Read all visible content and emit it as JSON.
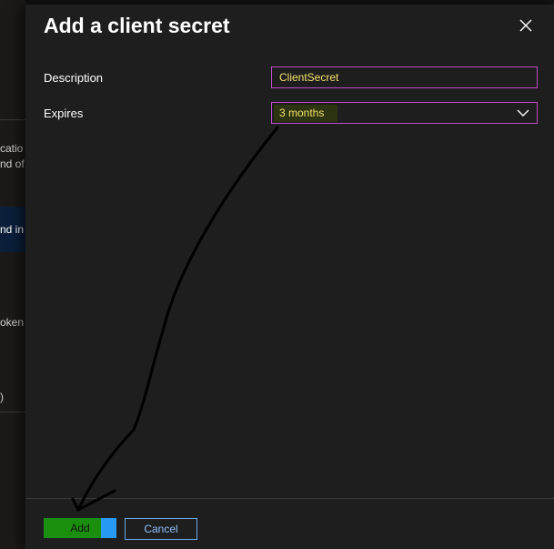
{
  "background": {
    "fragments": [
      "catio",
      "nd of",
      "nd in",
      "oken",
      ")"
    ],
    "banner_text": "nd in t"
  },
  "panel": {
    "title": "Add a client secret",
    "close_icon": "close-icon"
  },
  "form": {
    "description": {
      "label": "Description",
      "value": "ClientSecret"
    },
    "expires": {
      "label": "Expires",
      "value": "3 months",
      "chevron_icon": "chevron-down-icon"
    }
  },
  "footer": {
    "add_label": "Add",
    "cancel_label": "Cancel"
  },
  "colors": {
    "panel_bg": "#1e1e1e",
    "input_border": "#c24ac7",
    "input_text": "#f5e26b",
    "add_button": "#2899f5",
    "annotation_stroke": "#000000"
  }
}
